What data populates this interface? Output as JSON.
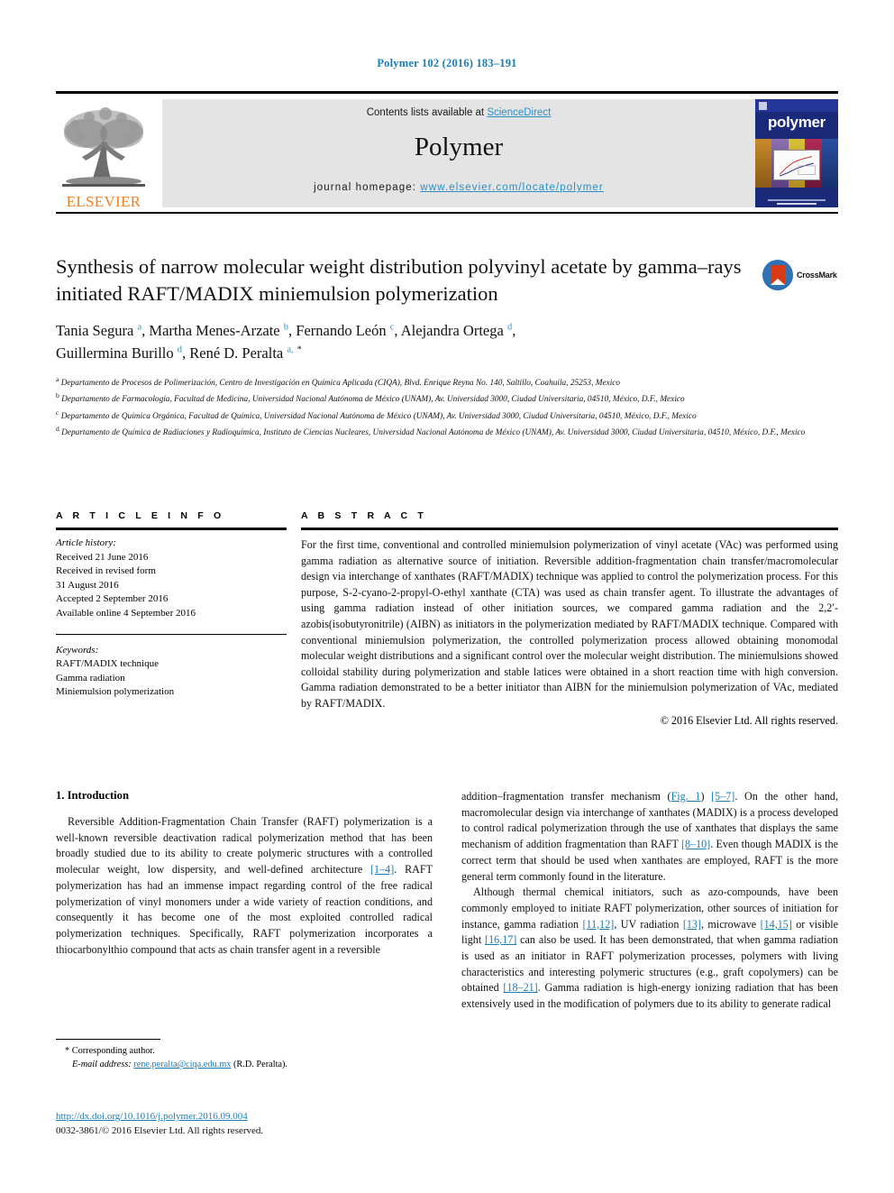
{
  "running_head": "Polymer 102 (2016) 183–191",
  "masthead": {
    "contents_prefix": "Contents lists available at ",
    "sciencedirect": "ScienceDirect",
    "journal_name": "Polymer",
    "homepage_prefix": "journal homepage: ",
    "homepage_url": "www.elsevier.com/locate/polymer",
    "publisher_logo_text": "ELSEVIER",
    "cover_title": "polymer"
  },
  "article": {
    "title": "Synthesis of narrow molecular weight distribution polyvinyl acetate by gamma–rays initiated RAFT/MADIX miniemulsion polymerization",
    "crossmark_label": "CrossMark",
    "authors_line_1": "Tania Segura a, Martha Menes-Arzate b, Fernando León c, Alejandra Ortega d,",
    "authors_line_2": "Guillermina Burillo d, René D. Peralta a, *",
    "authors": [
      {
        "name": "Tania Segura",
        "marks": "a"
      },
      {
        "name": "Martha Menes-Arzate",
        "marks": "b"
      },
      {
        "name": "Fernando León",
        "marks": "c"
      },
      {
        "name": "Alejandra Ortega",
        "marks": "d"
      },
      {
        "name": "Guillermina Burillo",
        "marks": "d"
      },
      {
        "name": "René D. Peralta",
        "marks": "a, *"
      }
    ],
    "affiliations": [
      {
        "mark": "a",
        "text": "Departamento de Procesos de Polimerización, Centro de Investigación en Química Aplicada (CIQA), Blvd. Enrique Reyna No. 140, Saltillo, Coahuila, 25253, Mexico"
      },
      {
        "mark": "b",
        "text": "Departamento de Farmacología, Facultad de Medicina, Universidad Nacional Autónoma de México (UNAM), Av. Universidad 3000, Ciudad Universitaria, 04510, México, D.F., Mexico"
      },
      {
        "mark": "c",
        "text": "Departamento de Química Orgánica, Facultad de Química, Universidad Nacional Autónoma de México (UNAM), Av. Universidad 3000, Ciudad Universitaria, 04510, México, D.F., Mexico"
      },
      {
        "mark": "d",
        "text": "Departamento de Química de Radiaciones y Radioquímica, Instituto de Ciencias Nucleares, Universidad Nacional Autónoma de México (UNAM), Av. Universidad 3000, Ciudad Universitaria, 04510, México, D.F., Mexico"
      }
    ]
  },
  "article_info": {
    "heading": "A R T I C L E  I N F O",
    "history_label": "Article history:",
    "history": [
      "Received 21 June 2016",
      "Received in revised form",
      "31 August 2016",
      "Accepted 2 September 2016",
      "Available online 4 September 2016"
    ],
    "keywords_label": "Keywords:",
    "keywords": [
      "RAFT/MADIX technique",
      "Gamma radiation",
      "Miniemulsion polymerization"
    ]
  },
  "abstract": {
    "heading": "A B S T R A C T",
    "text": "For the first time, conventional and controlled miniemulsion polymerization of vinyl acetate (VAc) was performed using gamma radiation as alternative source of initiation. Reversible addition-fragmentation chain transfer/macromolecular design via interchange of xanthates (RAFT/MADIX) technique was applied to control the polymerization process. For this purpose, S-2-cyano-2-propyl-O-ethyl xanthate (CTA) was used as chain transfer agent. To illustrate the advantages of using gamma radiation instead of other initiation sources, we compared gamma radiation and the 2,2′-azobis(isobutyronitrile) (AIBN) as initiators in the polymerization mediated by RAFT/MADIX technique. Compared with conventional miniemulsion polymerization, the controlled polymerization process allowed obtaining monomodal molecular weight distributions and a significant control over the molecular weight distribution. The miniemulsions showed colloidal stability during polymerization and stable latices were obtained in a short reaction time with high conversion. Gamma radiation demonstrated to be a better initiator than AIBN for the miniemulsion polymerization of VAc, mediated by RAFT/MADIX.",
    "copyright": "© 2016 Elsevier Ltd. All rights reserved."
  },
  "introduction": {
    "heading": "1. Introduction",
    "left_paragraph_part1": "Reversible Addition-Fragmentation Chain Transfer (RAFT) polymerization is a well-known reversible deactivation radical polymerization method that has been broadly studied due to its ability to create polymeric structures with a controlled molecular weight, low dispersity, and well-defined architecture ",
    "left_cite_1": "[1–4]",
    "left_paragraph_part2": ". RAFT polymerization has had an immense impact regarding control of the free radical polymerization of vinyl monomers under a wide variety of reaction conditions, and consequently it has become one of the most exploited controlled radical polymerization techniques. Specifically, RAFT polymerization incorporates a thiocarbonylthio compound that acts as chain transfer agent in a reversible",
    "right_p1_part1": "addition–fragmentation transfer mechanism (",
    "right_cite_fig": "Fig. 1",
    "right_p1_part2": ") ",
    "right_cite_57": "[5–7]",
    "right_p1_part3": ". On the other hand, macromolecular design via interchange of xanthates (MADIX) is a process developed to control radical polymerization through the use of xanthates that displays the same mechanism of addition fragmentation than RAFT ",
    "right_cite_810": "[8–10]",
    "right_p1_part4": ". Even though MADIX is the correct term that should be used when xanthates are employed, RAFT is the more general term commonly found in the literature.",
    "right_p2_part1": "Although thermal chemical initiators, such as azo-compounds, have been commonly employed to initiate RAFT polymerization, other sources of initiation for instance, gamma radiation ",
    "right_cite_1112": "[11,12]",
    "right_p2_part2": ", UV radiation ",
    "right_cite_13": "[13]",
    "right_p2_part3": ", microwave ",
    "right_cite_1415": "[14,15]",
    "right_p2_part4": " or visible light ",
    "right_cite_1617": "[16,17]",
    "right_p2_part5": " can also be used. It has been demonstrated, that when gamma radiation is used as an initiator in RAFT polymerization processes, polymers with living characteristics and interesting polymeric structures (e.g., graft copolymers) can be obtained ",
    "right_cite_1821": "[18–21]",
    "right_p2_part6": ". Gamma radiation is high-energy ionizing radiation that has been extensively used in the modification of polymers due to its ability to generate radical"
  },
  "footer": {
    "corresponding_author": "* Corresponding author.",
    "email_label": "E-mail address:",
    "email": "rene.peralta@ciqa.edu.mx",
    "email_suffix": "(R.D. Peralta).",
    "doi": "http://dx.doi.org/10.1016/j.polymer.2016.09.004",
    "issn_line": "0032-3861/© 2016 Elsevier Ltd. All rights reserved."
  },
  "colors": {
    "link_blue": "#1a7db6",
    "elsevier_orange": "#f08020",
    "masthead_gray": "#e4e4e4",
    "cover_blue": "#1b2a78"
  }
}
